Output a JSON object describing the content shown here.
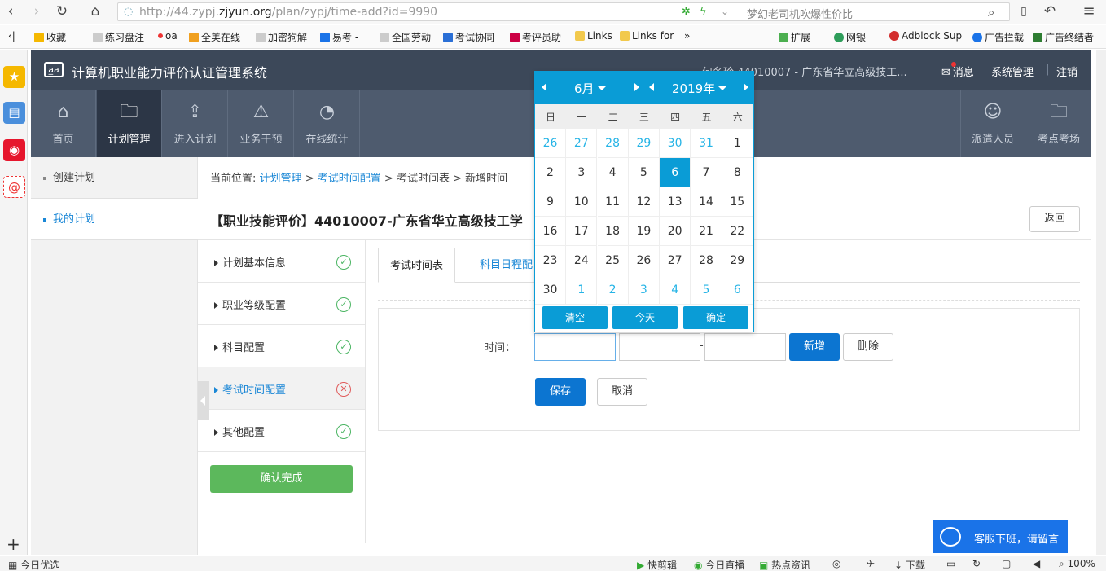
{
  "browser": {
    "url_prefix": "http://44.zypj.",
    "url_domain": "zjyun.org",
    "url_path": "/plan/zypj/time-add?id=9990",
    "search_hint": "梦幻老司机吹爆性价比"
  },
  "bookmarks": [
    {
      "label": "收藏",
      "color": "#f5b800"
    },
    {
      "label": "练习盘注",
      "color": "#bbb"
    },
    {
      "label": "oa",
      "color": "#e33"
    },
    {
      "label": "全美在线",
      "color": "#f0a020"
    },
    {
      "label": "加密狗解",
      "color": "#bbb"
    },
    {
      "label": "易考 -",
      "color": "#1a73e8"
    },
    {
      "label": "全国劳动",
      "color": "#bbb"
    },
    {
      "label": "考试协同",
      "color": "#2a6fd6"
    },
    {
      "label": "考评员助",
      "color": "#c04"
    },
    {
      "label": "Links",
      "color": "#f2c94c"
    },
    {
      "label": "Links for",
      "color": "#f2c94c"
    },
    {
      "label": "扩展",
      "color": "#4caf50"
    },
    {
      "label": "网银",
      "color": "#2e9d5a"
    },
    {
      "label": "Adblock Sup",
      "color": "#d32f2f"
    },
    {
      "label": "广告拦截",
      "color": "#1a73e8"
    },
    {
      "label": "广告终结者",
      "color": "#2e7d32"
    }
  ],
  "app": {
    "logo": "a̲a",
    "title": "计算机职业能力评价认证管理系统",
    "user": "何冬玲   44010007 - 广东省华立高级技工...",
    "messages": "消息",
    "system": "系统管理",
    "logout": "注销"
  },
  "nav": [
    {
      "label": "首页",
      "icon": "⌂"
    },
    {
      "label": "计划管理",
      "icon": "🗀"
    },
    {
      "label": "进入计划",
      "icon": "⇪"
    },
    {
      "label": "业务干预",
      "icon": "⚠"
    },
    {
      "label": "在线统计",
      "icon": "◔"
    },
    {
      "label": "派遣人员",
      "icon": "☺"
    },
    {
      "label": "考点考场",
      "icon": "🗀"
    }
  ],
  "left_menu": [
    "创建计划",
    "我的计划"
  ],
  "breadcrumb": {
    "prefix": "当前位置:",
    "c1": "计划管理",
    "c2": "考试时间配置",
    "c3": "考试时间表",
    "c4": "新增时间",
    "sep": ">"
  },
  "page_title": "【职业技能评价】44010007-广东省华立高级技工学",
  "back_label": "返回",
  "steps": [
    {
      "label": "计划基本信息",
      "ok": true
    },
    {
      "label": "职业等级配置",
      "ok": true
    },
    {
      "label": "科目配置",
      "ok": true
    },
    {
      "label": "考试时间配置",
      "ok": false
    },
    {
      "label": "其他配置",
      "ok": true
    }
  ],
  "confirm_label": "确认完成",
  "tabs": [
    "考试时间表",
    "科目日程配"
  ],
  "form": {
    "time_label": "时间：",
    "add_label": "新增",
    "del_label": "删除",
    "save_label": "保存",
    "cancel_label": "取消"
  },
  "calendar": {
    "month": "6月",
    "year": "2019年",
    "weekdays": [
      "日",
      "一",
      "二",
      "三",
      "四",
      "五",
      "六"
    ],
    "days": [
      [
        "26",
        "27",
        "28",
        "29",
        "30",
        "31",
        "1"
      ],
      [
        "2",
        "3",
        "4",
        "5",
        "6",
        "7",
        "8"
      ],
      [
        "9",
        "10",
        "11",
        "12",
        "13",
        "14",
        "15"
      ],
      [
        "16",
        "17",
        "18",
        "19",
        "20",
        "21",
        "22"
      ],
      [
        "23",
        "24",
        "25",
        "26",
        "27",
        "28",
        "29"
      ],
      [
        "30",
        "1",
        "2",
        "3",
        "4",
        "5",
        "6"
      ]
    ],
    "selected": "6",
    "clear": "清空",
    "today": "今天",
    "ok": "确定"
  },
  "chat_label": "客服下班，请留言",
  "status_bar": {
    "left": "今日优选",
    "items": [
      "快剪辑",
      "今日直播",
      "热点资讯",
      "下载"
    ],
    "zoom": "100%"
  }
}
